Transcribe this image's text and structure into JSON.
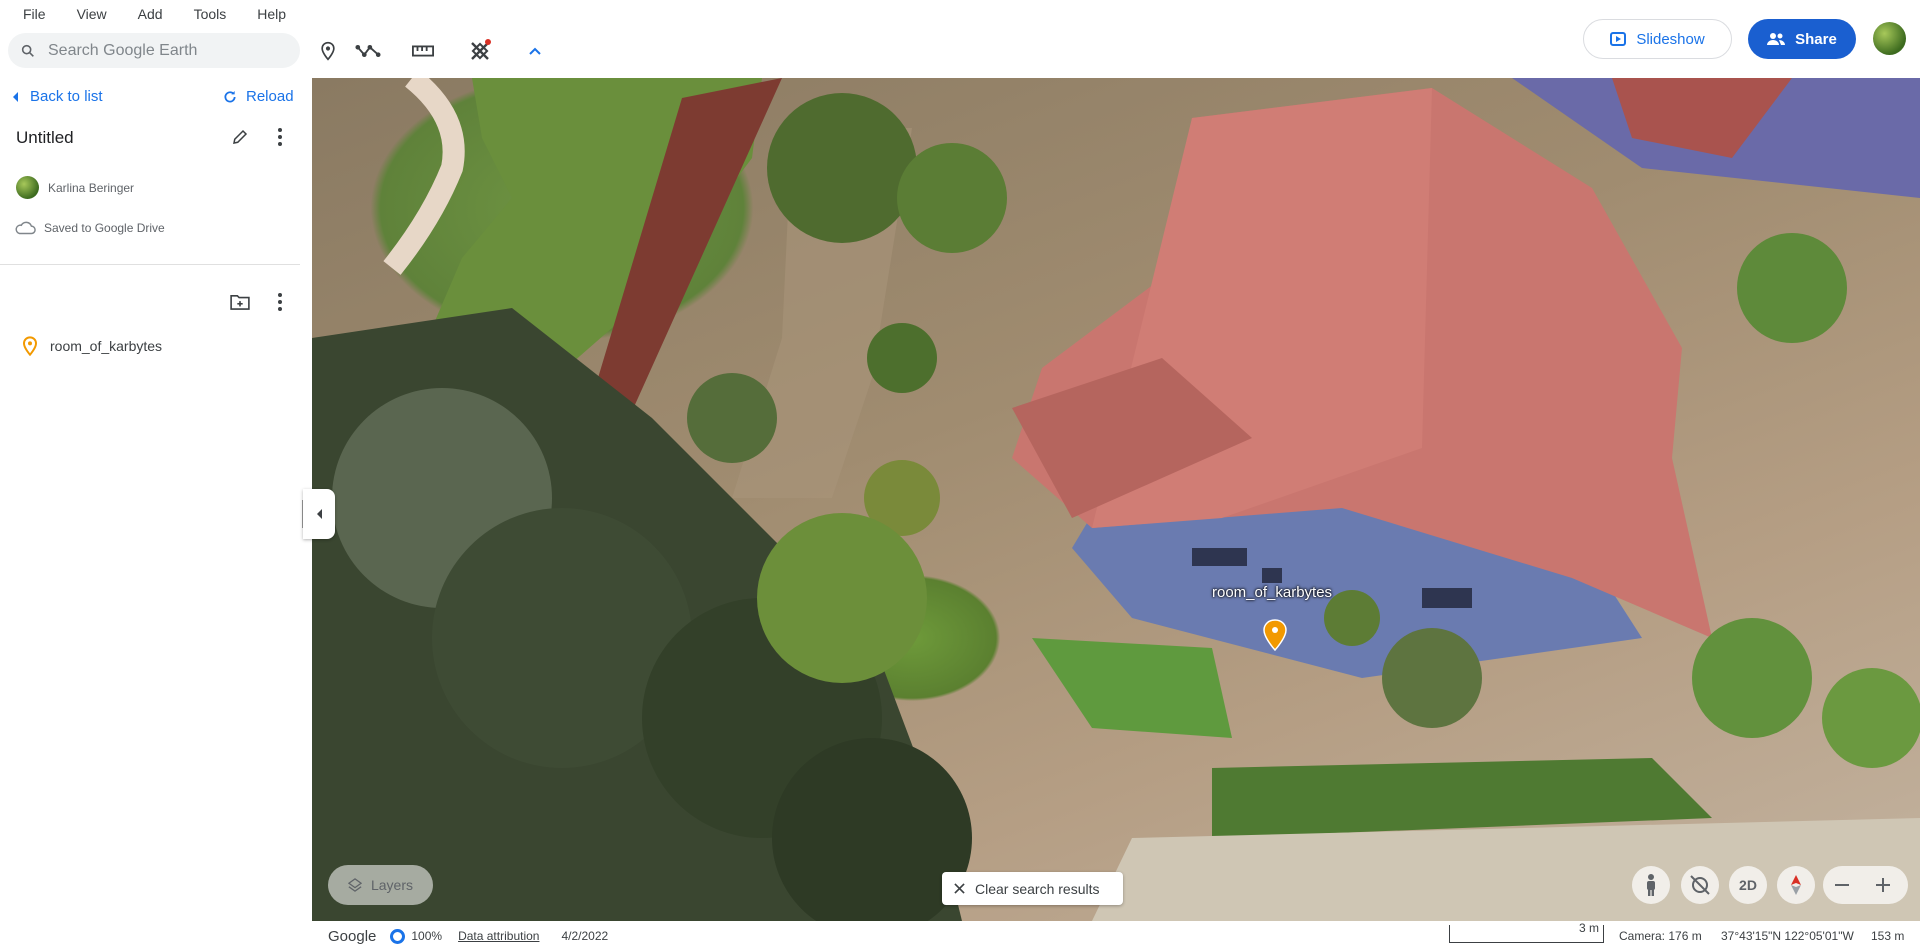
{
  "menu": [
    "File",
    "View",
    "Add",
    "Tools",
    "Help"
  ],
  "search": {
    "placeholder": "Search Google Earth"
  },
  "toolbar_icons": [
    "add-placemark-icon",
    "add-path-icon",
    "measure-icon",
    "data-layers-icon",
    "collapse-chevron-icon"
  ],
  "header": {
    "slideshow_label": "Slideshow",
    "share_label": "Share"
  },
  "panel": {
    "back_label": "Back to list",
    "reload_label": "Reload",
    "project_title": "Untitled",
    "owner_name": "Karlina Beringer",
    "saved_status": "Saved to Google Drive",
    "features": [
      {
        "label": "room_of_karbytes",
        "icon": "placemark-icon"
      }
    ]
  },
  "map": {
    "placemark_label": "room_of_karbytes",
    "layers_label": "Layers",
    "clear_label": "Clear search results",
    "view_mode_label": "2D"
  },
  "status": {
    "brand": "Google",
    "load_progress": "100%",
    "attribution": "Data attribution",
    "imagery_date": "4/2/2022",
    "scale_label": "3 m",
    "camera": "Camera: 176 m",
    "coordinates": "37°43'15\"N 122°05'01\"W",
    "elevation": "153 m"
  },
  "colors": {
    "accent": "#1a73e8",
    "share_bg": "#1a5fd0",
    "placemark": "#f29900"
  }
}
